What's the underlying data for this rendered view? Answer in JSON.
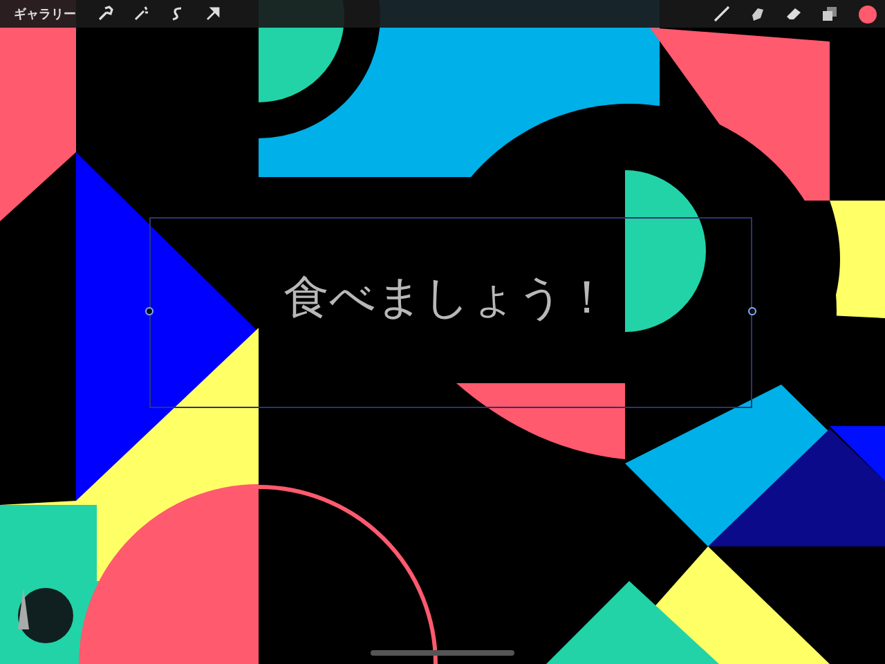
{
  "toolbar": {
    "gallery_label": "ギャラリー",
    "current_color": {
      "color": "#ff5a6e"
    }
  },
  "canvas": {
    "handwritten_text": "食べましょう！",
    "selection_active": true
  }
}
